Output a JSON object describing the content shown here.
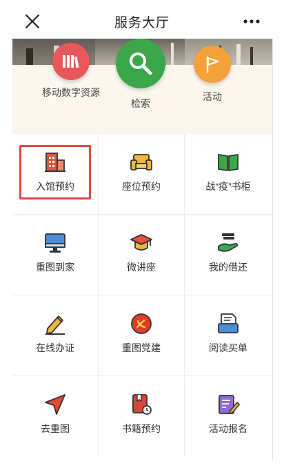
{
  "header": {
    "title": "服务大厅"
  },
  "hero": {
    "items": [
      {
        "label": "移动数字资源",
        "icon": "books-icon",
        "color": "#e8575a"
      },
      {
        "label": "检索",
        "icon": "search-icon",
        "color": "#3aa84a"
      },
      {
        "label": "活动",
        "icon": "flag-icon",
        "color": "#f3a23a"
      }
    ]
  },
  "grid": {
    "items": [
      {
        "label": "入馆预约",
        "icon": "building-icon",
        "color": "#e0593f",
        "highlighted": true
      },
      {
        "label": "座位预约",
        "icon": "sofa-icon",
        "color": "#f1b640"
      },
      {
        "label": "战“疫”书柜",
        "icon": "open-book-icon",
        "color": "#3aaa48"
      },
      {
        "label": "重图到家",
        "icon": "monitor-icon",
        "color": "#4a8fd6"
      },
      {
        "label": "微讲座",
        "icon": "graduation-cap-icon",
        "color": "#e8543f"
      },
      {
        "label": "我的借还",
        "icon": "hand-give-icon",
        "color": "#3aaa48"
      },
      {
        "label": "在线办证",
        "icon": "pencil-icon",
        "color": "#f2b53e"
      },
      {
        "label": "重图党建",
        "icon": "party-emblem-icon",
        "color": "#e23b2e"
      },
      {
        "label": "阅读买单",
        "icon": "receipt-icon",
        "color": "#4a8fd6"
      },
      {
        "label": "去重图",
        "icon": "navigate-arrow-icon",
        "color": "#e24a3a"
      },
      {
        "label": "书籍预约",
        "icon": "book-clock-icon",
        "color": "#d8453a"
      },
      {
        "label": "活动报名",
        "icon": "signup-form-icon",
        "color": "#8f6bd1"
      }
    ]
  }
}
